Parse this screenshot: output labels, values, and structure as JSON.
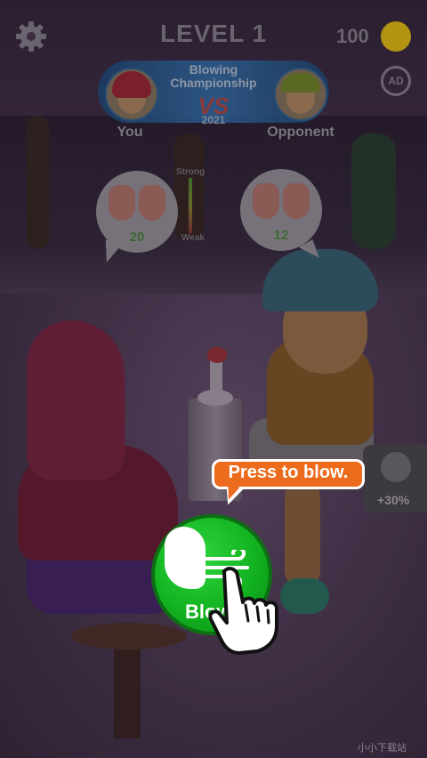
{
  "hud": {
    "level": "LEVEL 1",
    "coins": "100",
    "noads_label": "AD"
  },
  "banner": {
    "title_line1": "Blowing",
    "title_line2": "Championship",
    "vs": "VS",
    "year": "2021",
    "player_label": "You",
    "opponent_label": "Opponent"
  },
  "lungs": {
    "player_value": "20",
    "opponent_value": "12",
    "meter_top": "Strong",
    "meter_bottom": "Weak"
  },
  "boost": {
    "label": "+30%"
  },
  "tutorial": {
    "tooltip": "Press to blow.",
    "button_label": "Blow"
  },
  "watermark": "小小下载站",
  "colors": {
    "accent_orange": "#ec6b1c",
    "button_green": "#12b220",
    "banner_blue": "#2b5d8f"
  }
}
